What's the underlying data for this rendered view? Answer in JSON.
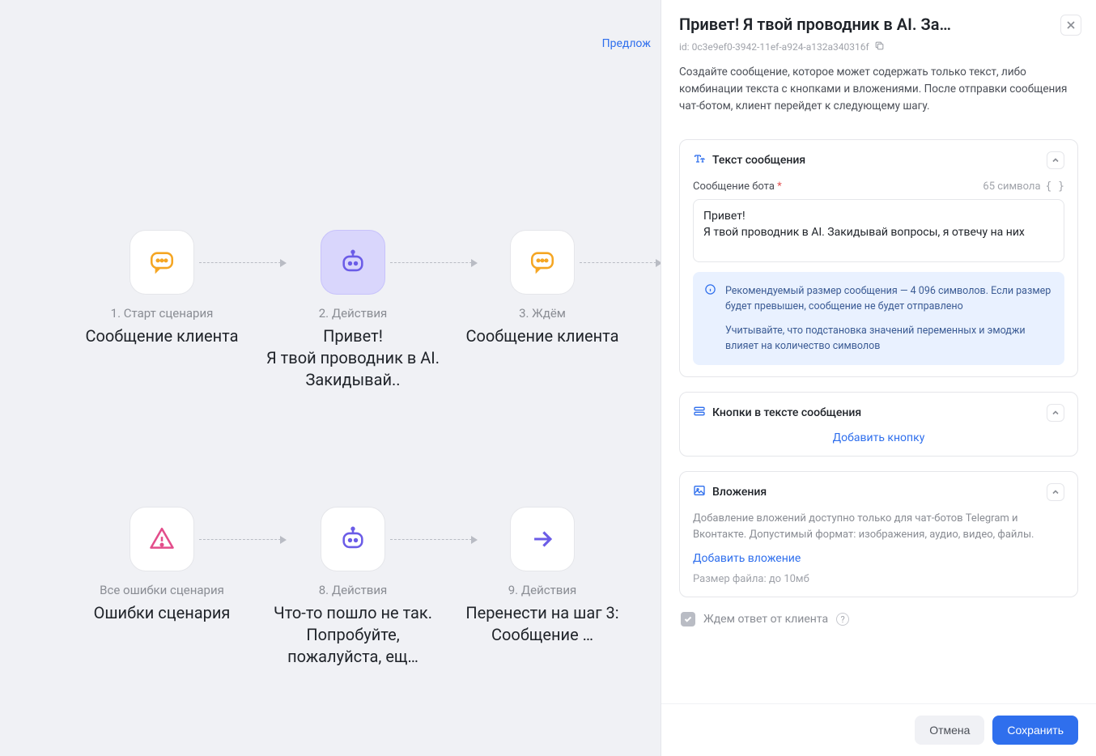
{
  "suggest": "Предлож",
  "nodes": {
    "n1": {
      "label": "1. Старт сценария",
      "title": "Сообщение клиента"
    },
    "n2": {
      "label": "2. Действия",
      "title": "Привет!\nЯ твой проводник в AI. Закидывай.."
    },
    "n3": {
      "label": "3. Ждём",
      "title": "Сообщение клиента"
    },
    "n7": {
      "label": "Все ошибки сценария",
      "title": "Ошибки сценария"
    },
    "n8": {
      "label": "8. Действия",
      "title": "Что-то пошло не так. Попробуйте, пожалуйста, ещ…"
    },
    "n9": {
      "label": "9. Действия",
      "title": "Перенести на шаг 3: Сообщение …"
    }
  },
  "panel": {
    "title": "Привет! Я твой проводник в AI. За…",
    "id": "id: 0c3e9ef0-3942-11ef-a924-a132a340316f",
    "desc": "Создайте сообщение, которое может содержать только текст, либо комбинации текста с кнопками и вложениями. После отправки сообщения чат-ботом, клиент перейдет к следующему шагу."
  },
  "text_section": {
    "head": "Текст сообщения",
    "label": "Сообщение бота",
    "char_count": "65 символа",
    "value": "Привет!\nЯ твой проводник в AI. Закидывай вопросы, я отвечу на них",
    "info1": "Рекомендуемый размер сообщения — 4 096 символов. Если размер будет превышен, сообщение не будет отправлено",
    "info2": "Учитывайте, что подстановка значений переменных и эмоджи влияет на количество символов"
  },
  "buttons_section": {
    "head": "Кнопки в тексте сообщения",
    "add": "Добавить кнопку"
  },
  "attach_section": {
    "head": "Вложения",
    "desc": "Добавление вложений доступно только для чат-ботов Telegram и Вконтакте. Допустимый формат: изображения, аудио, видео, файлы.",
    "add": "Добавить вложение",
    "size": "Размер файла: до 10мб"
  },
  "wait_label": "Ждем ответ от клиента",
  "footer": {
    "cancel": "Отмена",
    "save": "Сохранить"
  }
}
